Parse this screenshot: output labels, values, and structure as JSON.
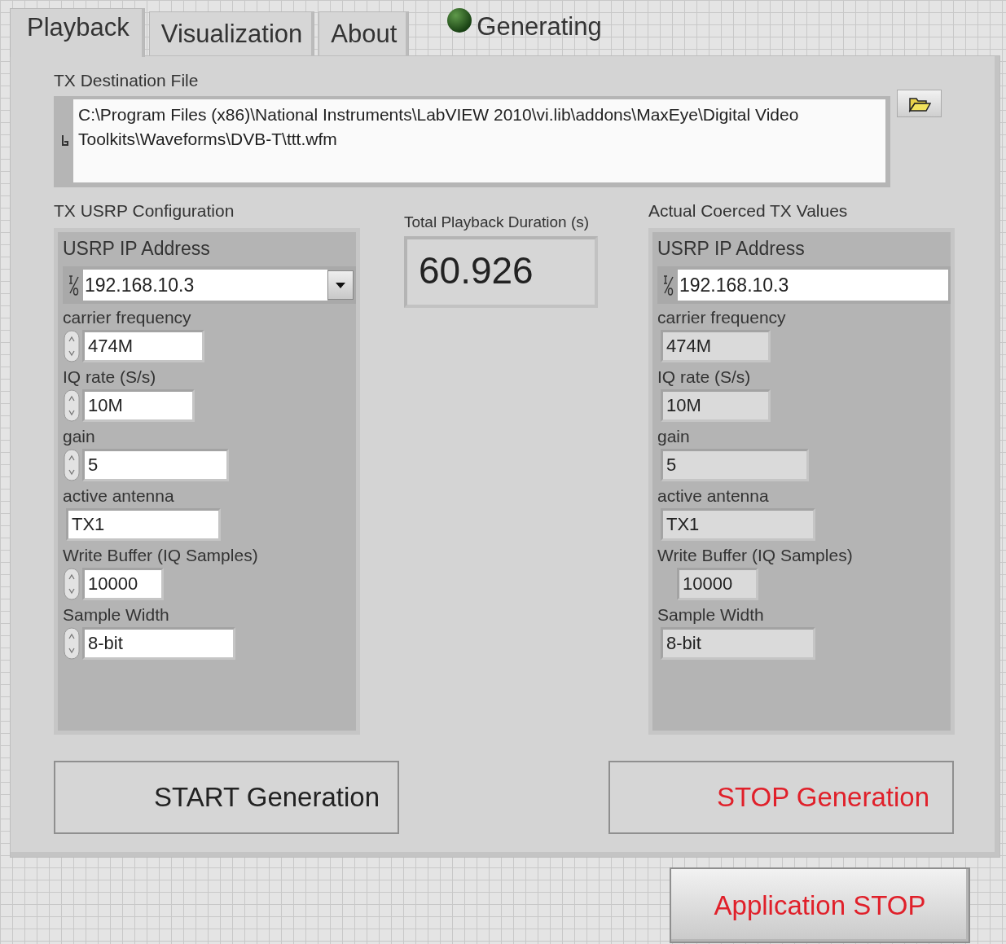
{
  "tabs": [
    {
      "label": "Playback",
      "selected": true
    },
    {
      "label": "Visualization",
      "selected": false
    },
    {
      "label": "About",
      "selected": false
    }
  ],
  "status_led": {
    "label": "Generating",
    "on": false
  },
  "destination_file": {
    "label": "TX Destination File",
    "value": "C:\\Program Files (x86)\\National Instruments\\LabVIEW 2010\\vi.lib\\addons\\MaxEye\\Digital Video Toolkits\\Waveforms\\DVB-T\\ttt.wfm"
  },
  "configuration": {
    "label": "TX USRP Configuration",
    "fields": [
      {
        "kind": "ip_dropdown",
        "label": "USRP IP Address",
        "value": "192.168.10.3"
      },
      {
        "kind": "spinner",
        "label": "carrier frequency",
        "value": "474M"
      },
      {
        "kind": "spinner",
        "label": "IQ rate (S/s)",
        "value": "10M"
      },
      {
        "kind": "spinner",
        "label": "gain",
        "value": "5"
      },
      {
        "kind": "text",
        "label": "active antenna",
        "value": "TX1"
      },
      {
        "kind": "spinner",
        "label": "Write Buffer (IQ Samples)",
        "value": "10000"
      },
      {
        "kind": "spinner",
        "label": "Sample Width",
        "value": "8-bit"
      }
    ]
  },
  "duration": {
    "label": "Total Playback Duration (s)",
    "value": "60.926"
  },
  "coerced": {
    "label": "Actual Coerced TX Values",
    "fields": [
      {
        "kind": "ip",
        "label": "USRP IP Address",
        "value": "192.168.10.3"
      },
      {
        "kind": "readout",
        "label": "carrier frequency",
        "value": "474M"
      },
      {
        "kind": "readout",
        "label": "IQ rate (S/s)",
        "value": "10M"
      },
      {
        "kind": "readout",
        "label": "gain",
        "value": "5"
      },
      {
        "kind": "readout",
        "label": "active antenna",
        "value": "TX1"
      },
      {
        "kind": "readout",
        "label": "Write Buffer (IQ Samples)",
        "value": "10000"
      },
      {
        "kind": "readout",
        "label": "Sample Width",
        "value": "8-bit"
      }
    ]
  },
  "buttons": [
    {
      "kind": "start",
      "label": "START Generation"
    },
    {
      "kind": "stop",
      "label": "STOP Generation"
    }
  ],
  "app_stop": {
    "label": "Application STOP"
  }
}
